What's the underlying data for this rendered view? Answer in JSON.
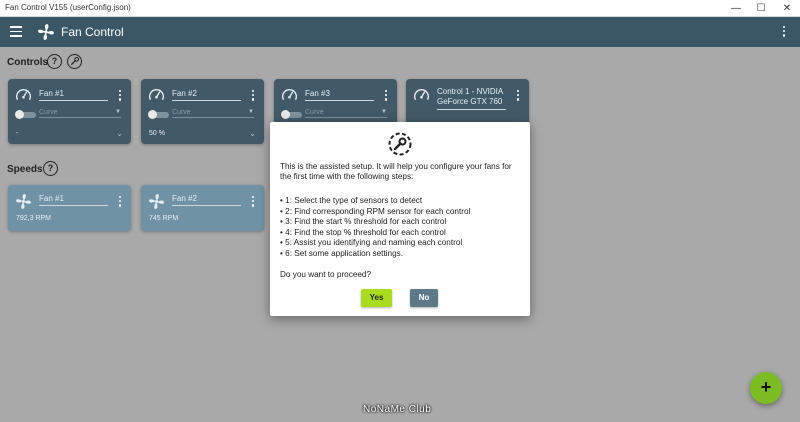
{
  "window": {
    "title": "Fan Control V155 (userConfig.json)",
    "minimize": "—",
    "maximize": "☐",
    "close": "✕"
  },
  "appbar": {
    "title": "Fan Control"
  },
  "controls": {
    "label": "Controls",
    "help": "?",
    "cards": [
      {
        "name": "Fan #1",
        "curve": "Curve",
        "value": "-"
      },
      {
        "name": "Fan #2",
        "curve": "Curve",
        "value": "50 %"
      },
      {
        "name": "Fan #3",
        "curve": "Curve",
        "value": ""
      },
      {
        "name": "Control 1 - NVIDIA GeForce GTX 760",
        "curve": "",
        "value": ""
      }
    ]
  },
  "speeds": {
    "label": "Speeds",
    "help": "?",
    "cards": [
      {
        "name": "Fan #1",
        "value": "792,3 RPM"
      },
      {
        "name": "Fan #2",
        "value": "745 RPM"
      }
    ]
  },
  "dialog": {
    "intro": "This is the assisted setup. It will help you configure your fans for the first time with the following steps:",
    "steps": [
      "• 1: Select the type of sensors to detect",
      "• 2: Find corresponding RPM sensor for each control",
      "• 3: Find the start % threshold for each control",
      "• 4: Find the stop % threshold for each control",
      "• 5: Assist you identifying and naming each control",
      "• 6: Set some application settings."
    ],
    "question": "Do you want to proceed?",
    "yes": "Yes",
    "no": "No"
  },
  "fab": "+",
  "watermark": "NoNaMe Club",
  "colors": {
    "appbar": "#3b5766",
    "control_card": "#425a67",
    "speed_card": "#6f92a5",
    "yes_button": "#a8dc1c",
    "no_button": "#5d7887",
    "fab": "#7cbd24"
  }
}
